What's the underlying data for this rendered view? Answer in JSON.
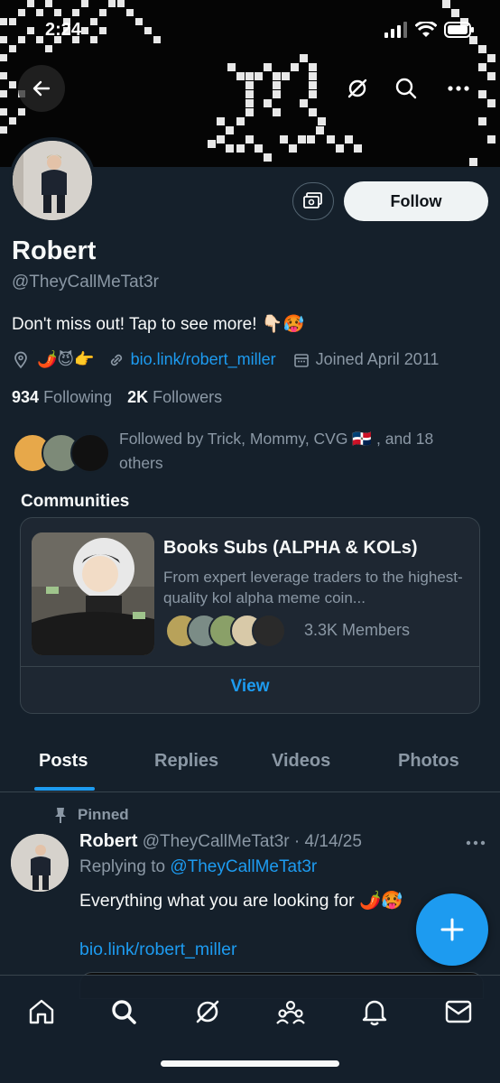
{
  "status_bar": {
    "time": "2:24"
  },
  "profile": {
    "name": "Robert",
    "handle": "@TheyCallMeTat3r",
    "bio": "Don't miss out! Tap to see more! 👇🏻🥵",
    "location_emojis": "🌶️😈👉",
    "website": "bio.link/robert_miller",
    "joined": "Joined April 2011",
    "following_count": "934",
    "following_label": "Following",
    "followers_count": "2K",
    "followers_label": "Followers",
    "followed_by": "Followed by Trick, Mommy, CVG 🇩🇴 , and 18 others",
    "follow_button": "Follow"
  },
  "communities": {
    "title": "Communities",
    "card": {
      "name": "Books Subs (ALPHA & KOLs)",
      "description": "From expert leverage traders to the highest-quality kol alpha meme coin...",
      "members": "3.3K Members",
      "view_label": "View"
    }
  },
  "tabs": [
    {
      "label": "Posts",
      "active": true
    },
    {
      "label": "Replies",
      "active": false
    },
    {
      "label": "Videos",
      "active": false
    },
    {
      "label": "Photos",
      "active": false
    }
  ],
  "pinned_post": {
    "pinned_label": "Pinned",
    "author_name": "Robert",
    "author_handle": "@TheyCallMeTat3r",
    "date": "· 4/14/25",
    "replying_prefix": "Replying to",
    "replying_to": "@TheyCallMeTat3r",
    "text": "Everything what you are looking for 🌶️🥵",
    "link": "bio.link/robert_miller"
  },
  "nav_icons": [
    "home-icon",
    "search-icon",
    "grok-icon",
    "communities-icon",
    "notifications-icon",
    "messages-icon"
  ],
  "colors": {
    "background": "#15202b",
    "accent": "#1d9bf0",
    "secondary_text": "#8b98a5"
  }
}
